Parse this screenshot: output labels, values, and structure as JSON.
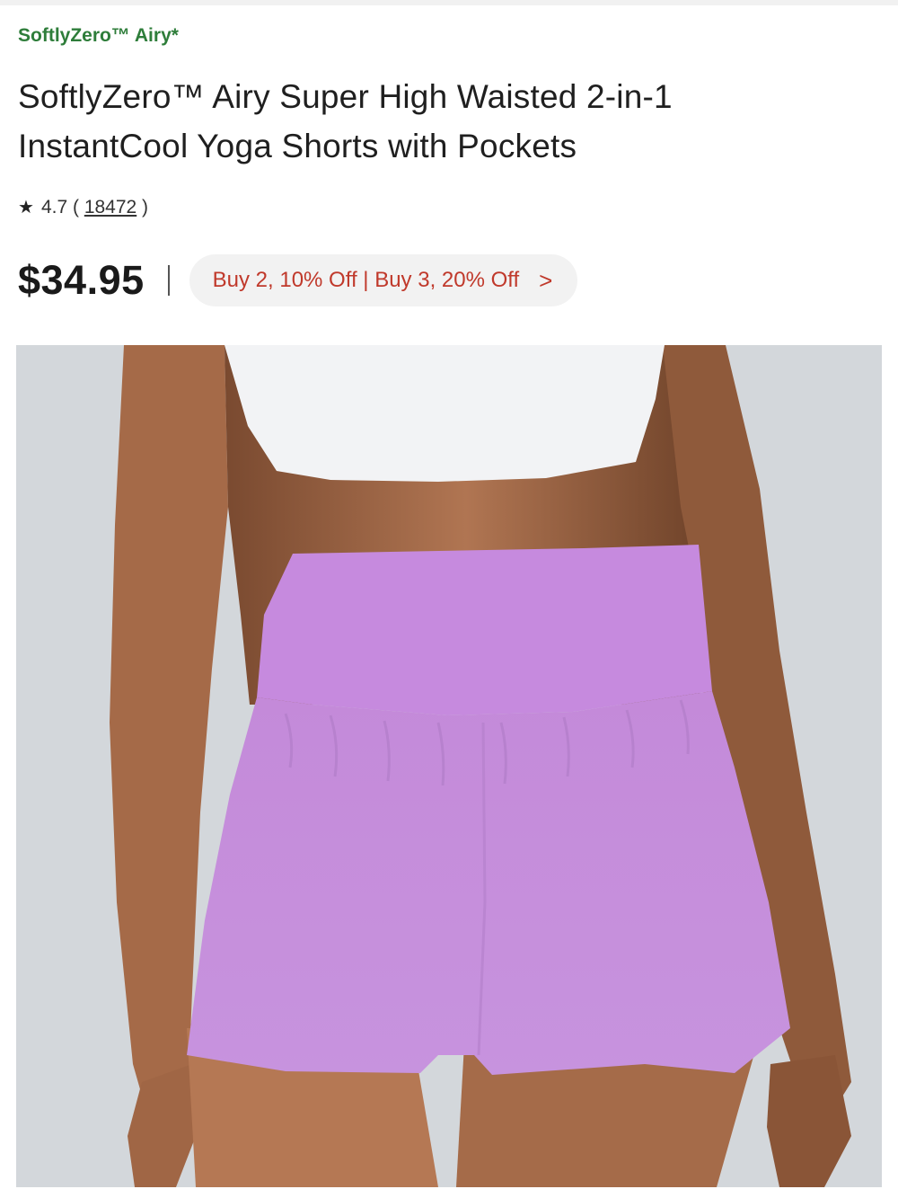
{
  "breadcrumb": "SoftlyZero™ Airy*",
  "product": {
    "title": "SoftlyZero™ Airy Super High Waisted 2-in-1 InstantCool Yoga Shorts with Pockets",
    "rating": "4.7",
    "review_count": "18472",
    "price": "$34.95",
    "promo": "Buy 2, 10% Off | Buy 3, 20% Off",
    "image_alt": "Lilac high waisted 2-in-1 yoga shorts worn with white crop top"
  },
  "icons": {
    "rating": "star-icon",
    "promo": "chevron-right-icon"
  },
  "colors": {
    "brand_green": "#2e7d3a",
    "promo_red": "#c0392b",
    "shorts": "#c88ee0",
    "background": "#d3d7db"
  }
}
